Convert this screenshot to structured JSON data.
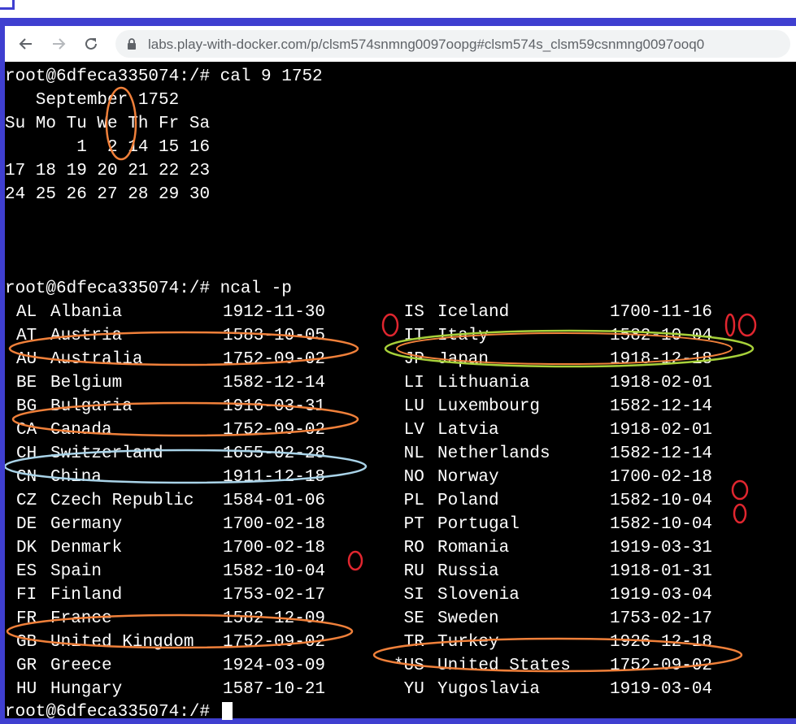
{
  "browser": {
    "url": "labs.play-with-docker.com/p/clsm574snmng0097oopg#clsm574s_clsm59csnmng0097ooq0",
    "back_icon": "arrow-left-icon",
    "forward_icon": "arrow-right-icon",
    "reload_icon": "reload-icon",
    "lock_icon": "lock-icon"
  },
  "terminal": {
    "cmd1": "root@6dfeca335074:/# cal 9 1752",
    "cal_title": "   September 1752",
    "cal_header": "Su Mo Tu We Th Fr Sa",
    "cal_rows": [
      "       1  2 14 15 16",
      "17 18 19 20 21 22 23",
      "24 25 26 27 28 29 30"
    ],
    "cmd2": "root@6dfeca335074:/# ncal -p",
    "countries_left": [
      {
        "code": "AL",
        "name": "Albania",
        "date": "1912-11-30"
      },
      {
        "code": "AT",
        "name": "Austria",
        "date": "1583-10-05"
      },
      {
        "code": "AU",
        "name": "Australia",
        "date": "1752-09-02"
      },
      {
        "code": "BE",
        "name": "Belgium",
        "date": "1582-12-14"
      },
      {
        "code": "BG",
        "name": "Bulgaria",
        "date": "1916-03-31"
      },
      {
        "code": "CA",
        "name": "Canada",
        "date": "1752-09-02"
      },
      {
        "code": "CH",
        "name": "Switzerland",
        "date": "1655-02-28"
      },
      {
        "code": "CN",
        "name": "China",
        "date": "1911-12-18"
      },
      {
        "code": "CZ",
        "name": "Czech Republic",
        "date": "1584-01-06"
      },
      {
        "code": "DE",
        "name": "Germany",
        "date": "1700-02-18"
      },
      {
        "code": "DK",
        "name": "Denmark",
        "date": "1700-02-18"
      },
      {
        "code": "ES",
        "name": "Spain",
        "date": "1582-10-04"
      },
      {
        "code": "FI",
        "name": "Finland",
        "date": "1753-02-17"
      },
      {
        "code": "FR",
        "name": "France",
        "date": "1582-12-09"
      },
      {
        "code": "GB",
        "name": "United Kingdom",
        "date": "1752-09-02"
      },
      {
        "code": "GR",
        "name": "Greece",
        "date": "1924-03-09"
      },
      {
        "code": "HU",
        "name": "Hungary",
        "date": "1587-10-21"
      }
    ],
    "countries_right": [
      {
        "code": " IS",
        "name": "Iceland",
        "date": "1700-11-16"
      },
      {
        "code": " IT",
        "name": "Italy",
        "date": "1582-10-04"
      },
      {
        "code": " JP",
        "name": "Japan",
        "date": "1918-12-18"
      },
      {
        "code": " LI",
        "name": "Lithuania",
        "date": "1918-02-01"
      },
      {
        "code": " LU",
        "name": "Luxembourg",
        "date": "1582-12-14"
      },
      {
        "code": " LV",
        "name": "Latvia",
        "date": "1918-02-01"
      },
      {
        "code": " NL",
        "name": "Netherlands",
        "date": "1582-12-14"
      },
      {
        "code": " NO",
        "name": "Norway",
        "date": "1700-02-18"
      },
      {
        "code": " PL",
        "name": "Poland",
        "date": "1582-10-04"
      },
      {
        "code": " PT",
        "name": "Portugal",
        "date": "1582-10-04"
      },
      {
        "code": " RO",
        "name": "Romania",
        "date": "1919-03-31"
      },
      {
        "code": " RU",
        "name": "Russia",
        "date": "1918-01-31"
      },
      {
        "code": " SI",
        "name": "Slovenia",
        "date": "1919-03-04"
      },
      {
        "code": " SE",
        "name": "Sweden",
        "date": "1753-02-17"
      },
      {
        "code": " TR",
        "name": "Turkey",
        "date": "1926-12-18"
      },
      {
        "code": "*US",
        "name": "United States",
        "date": "1752-09-02"
      },
      {
        "code": " YU",
        "name": "Yugoslavia",
        "date": "1919-03-04"
      }
    ],
    "prompt_final": "root@6dfeca335074:/#"
  },
  "annotations": {
    "orange": "#f0803a",
    "red": "#e0262f",
    "blue": "#a9d3e8",
    "green": "#a7d13a"
  }
}
